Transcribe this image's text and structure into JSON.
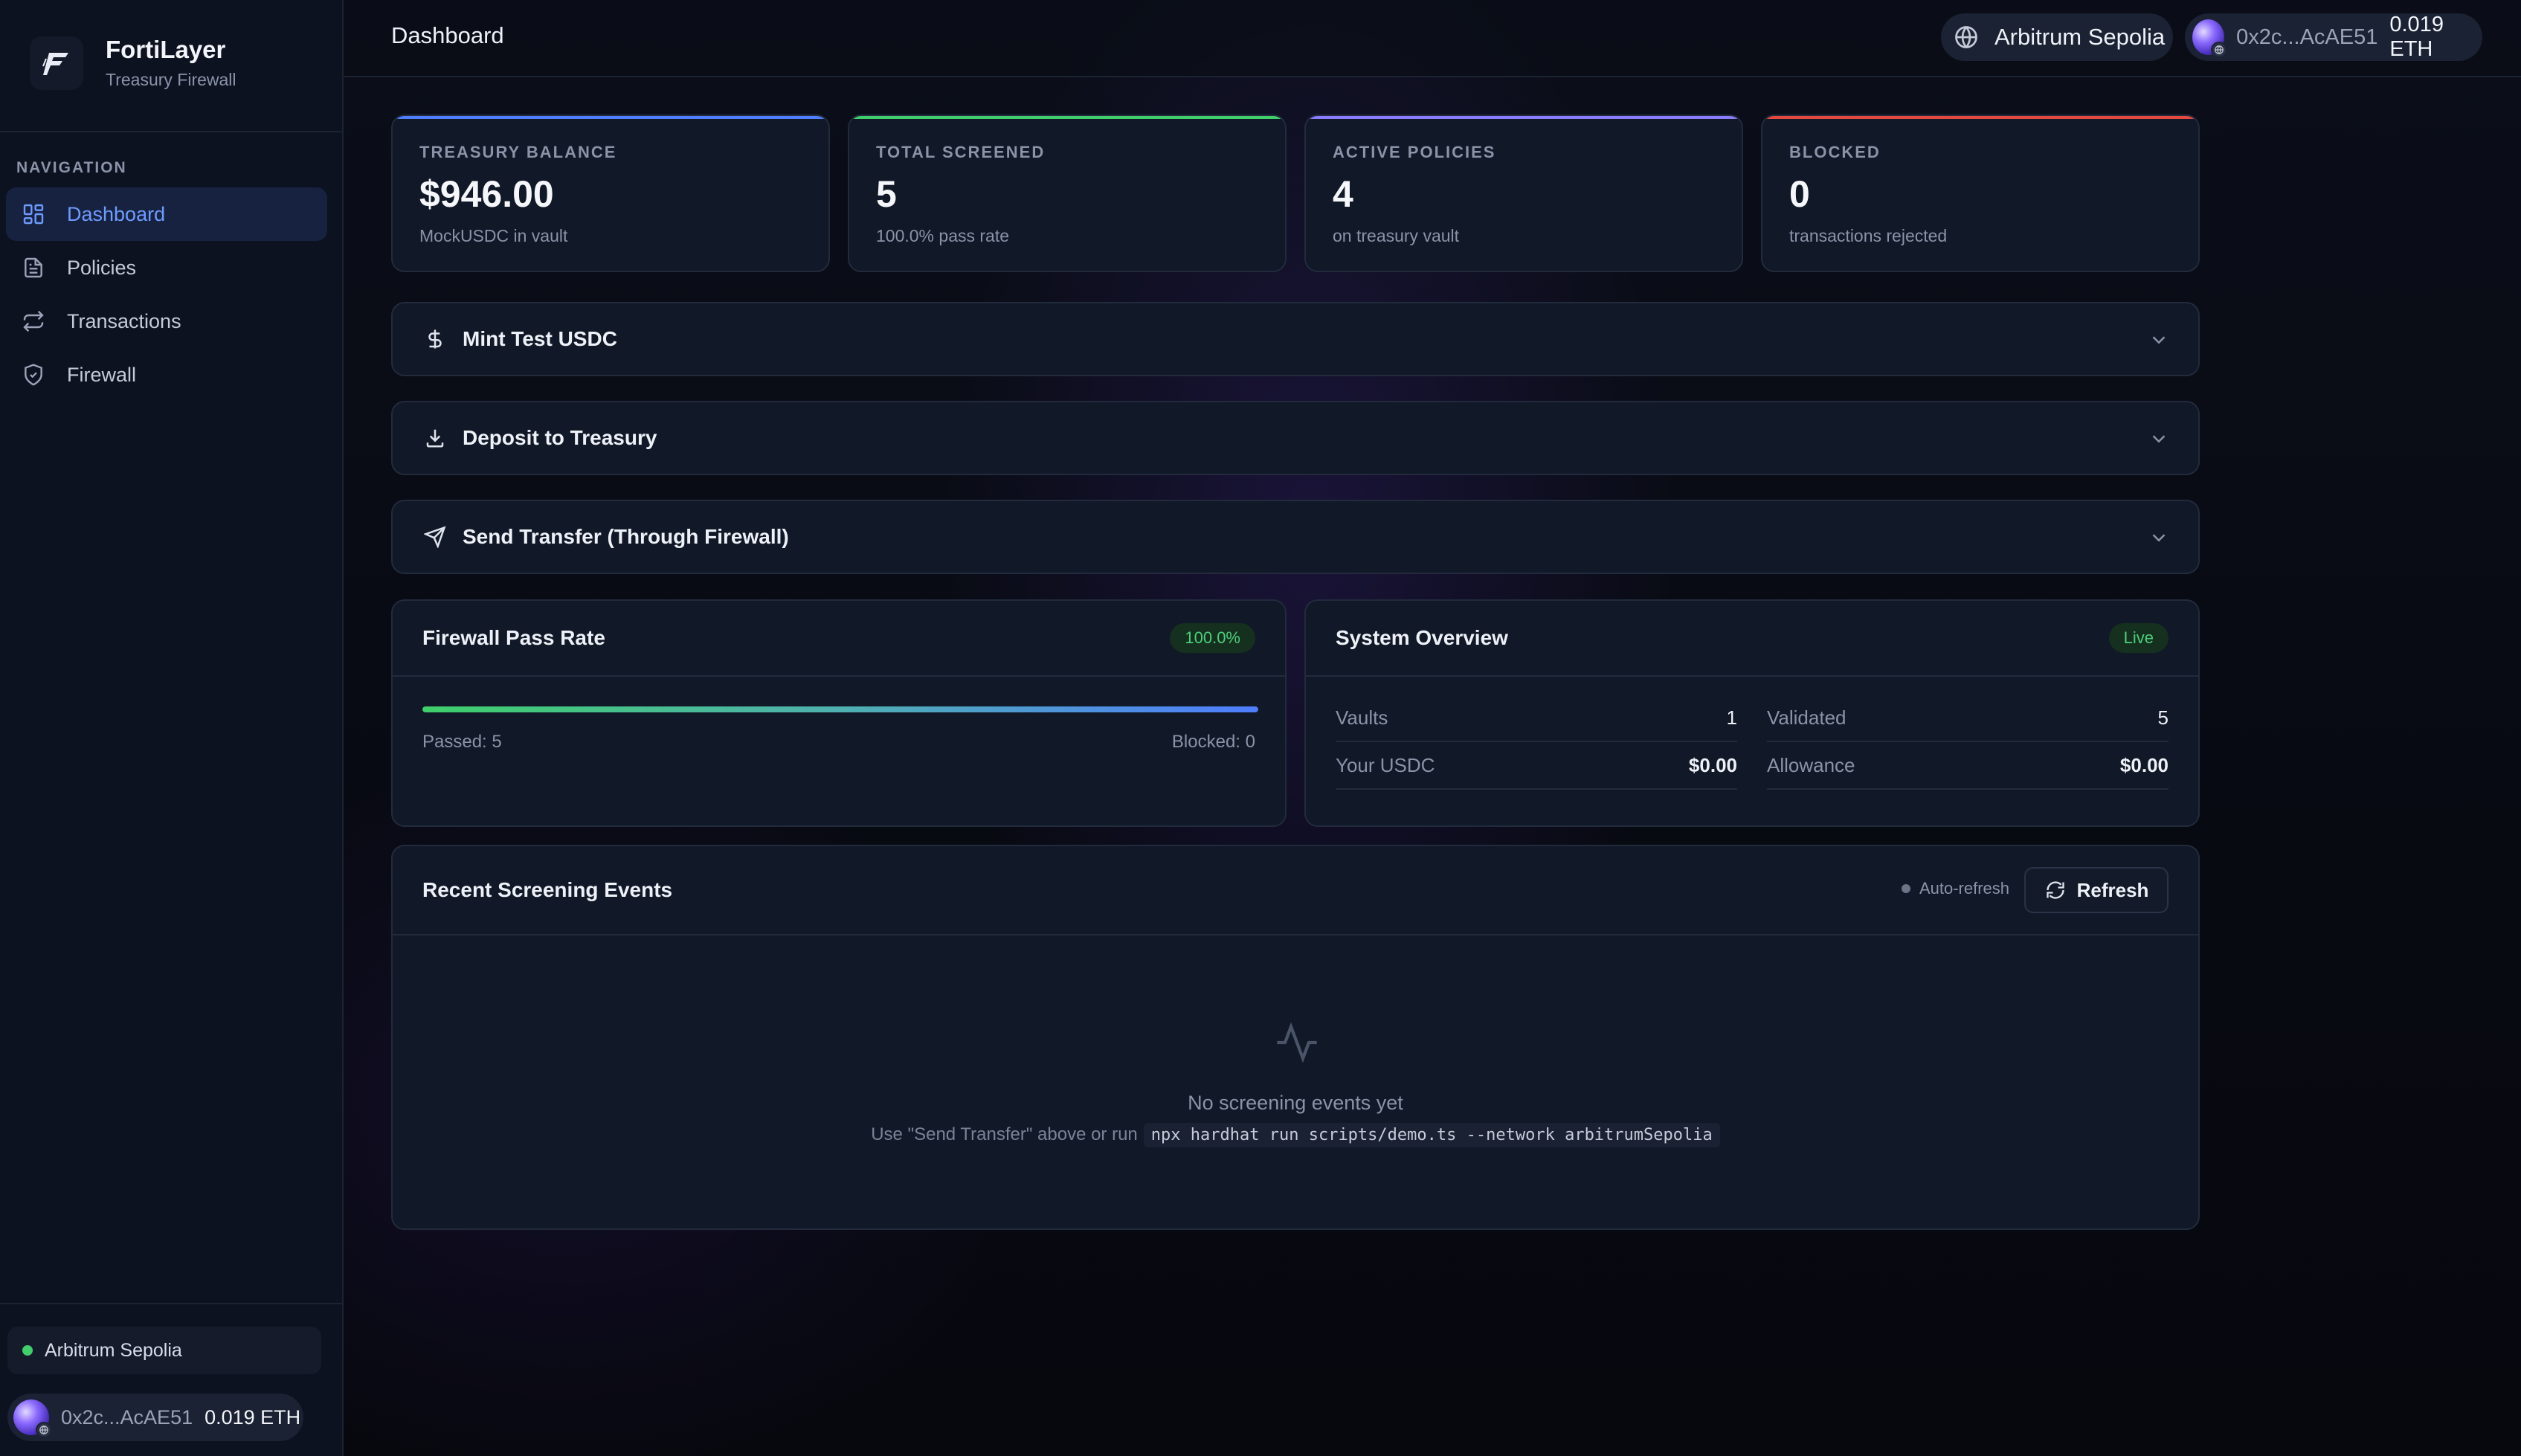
{
  "brand": {
    "name": "FortiLayer",
    "subtitle": "Treasury Firewall"
  },
  "nav": {
    "title": "NAVIGATION",
    "items": [
      {
        "label": "Dashboard",
        "icon": "grid-icon",
        "active": true
      },
      {
        "label": "Policies",
        "icon": "document-icon",
        "active": false
      },
      {
        "label": "Transactions",
        "icon": "swap-icon",
        "active": false
      },
      {
        "label": "Firewall",
        "icon": "shield-icon",
        "active": false
      }
    ]
  },
  "sidebar_footer": {
    "network": "Arbitrum Sepolia",
    "wallet_address": "0x2c...AcAE51",
    "wallet_balance": "0.019 ETH"
  },
  "header": {
    "title": "Dashboard",
    "network": "Arbitrum Sepolia",
    "wallet_address": "0x2c...AcAE51",
    "wallet_balance": "0.019 ETH"
  },
  "stats": [
    {
      "label": "TREASURY BALANCE",
      "value": "$946.00",
      "sub": "MockUSDC in vault",
      "accent": "#4f7dff"
    },
    {
      "label": "TOTAL SCREENED",
      "value": "5",
      "sub": "100.0% pass rate",
      "accent": "#3fcf6b"
    },
    {
      "label": "ACTIVE POLICIES",
      "value": "4",
      "sub": "on treasury vault",
      "accent": "#8b7bff"
    },
    {
      "label": "BLOCKED",
      "value": "0",
      "sub": "transactions rejected",
      "accent": "#e5483d"
    }
  ],
  "actions": [
    {
      "label": "Mint Test USDC",
      "icon": "dollar-icon"
    },
    {
      "label": "Deposit to Treasury",
      "icon": "download-icon"
    },
    {
      "label": "Send Transfer (Through Firewall)",
      "icon": "send-icon"
    }
  ],
  "pass_rate": {
    "title": "Firewall Pass Rate",
    "badge": "100.0%",
    "fraction": 1.0,
    "passed_label": "Passed: 5",
    "blocked_label": "Blocked: 0"
  },
  "overview": {
    "title": "System Overview",
    "badge": "Live",
    "rows": [
      {
        "key": "Vaults",
        "value": "1"
      },
      {
        "key": "Validated",
        "value": "5"
      },
      {
        "key": "Your USDC",
        "value": "$0.00"
      },
      {
        "key": "Allowance",
        "value": "$0.00"
      }
    ]
  },
  "events": {
    "title": "Recent Screening Events",
    "auto_refresh": "Auto-refresh",
    "refresh_label": "Refresh",
    "empty_title": "No screening events yet",
    "empty_sub_prefix": "Use \"Send Transfer\" above or run",
    "empty_code": "npx hardhat run scripts/demo.ts --network arbitrumSepolia"
  },
  "colors": {
    "accent_blue": "#4f7dff",
    "success_green": "#3fcf6b",
    "danger_red": "#e5483d",
    "purple": "#8b7bff"
  }
}
